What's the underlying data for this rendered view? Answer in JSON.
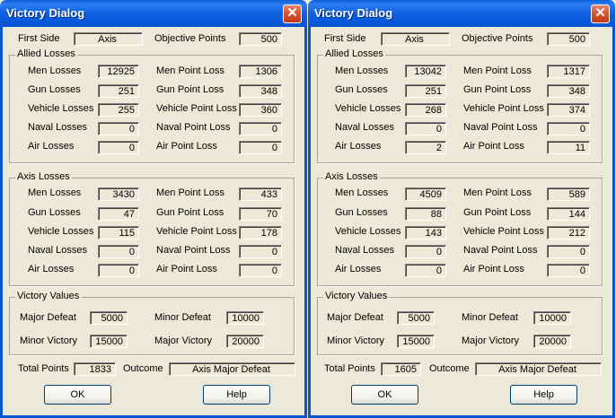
{
  "dialogs": [
    {
      "title": "Victory Dialog",
      "close_glyph": "✕",
      "labels": {
        "first_side": "First Side",
        "objective_points": "Objective Points",
        "allied_losses": "Allied Losses",
        "axis_losses": "Axis Losses",
        "men_losses": "Men Losses",
        "gun_losses": "Gun Losses",
        "vehicle_losses": "Vehicle Losses",
        "naval_losses": "Naval Losses",
        "air_losses": "Air Losses",
        "men_point_loss": "Men Point Loss",
        "gun_point_loss": "Gun Point Loss",
        "vehicle_point_loss": "Vehicle Point Loss",
        "naval_point_loss": "Naval Point Loss",
        "air_point_loss": "Air Point Loss",
        "victory_values": "Victory Values",
        "major_defeat": "Major Defeat",
        "minor_defeat": "Minor Defeat",
        "minor_victory": "Minor Victory",
        "major_victory": "Major Victory",
        "total_points": "Total Points",
        "outcome": "Outcome"
      },
      "first_side": "Axis",
      "objective_points": "500",
      "allied": {
        "men_losses": "12925",
        "gun_losses": "251",
        "vehicle_losses": "255",
        "naval_losses": "0",
        "air_losses": "0",
        "men_point_loss": "1306",
        "gun_point_loss": "348",
        "vehicle_point_loss": "360",
        "naval_point_loss": "0",
        "air_point_loss": "0"
      },
      "axis": {
        "men_losses": "3430",
        "gun_losses": "47",
        "vehicle_losses": "115",
        "naval_losses": "0",
        "air_losses": "0",
        "men_point_loss": "433",
        "gun_point_loss": "70",
        "vehicle_point_loss": "178",
        "naval_point_loss": "0",
        "air_point_loss": "0"
      },
      "victory": {
        "major_defeat": "5000",
        "minor_defeat": "10000",
        "minor_victory": "15000",
        "major_victory": "20000"
      },
      "total_points": "1833",
      "outcome": "Axis Major Defeat",
      "buttons": {
        "ok": "OK",
        "help": "Help"
      }
    },
    {
      "title": "Victory Dialog",
      "close_glyph": "✕",
      "labels": {
        "first_side": "First Side",
        "objective_points": "Objective Points",
        "allied_losses": "Allied Losses",
        "axis_losses": "Axis Losses",
        "men_losses": "Men Losses",
        "gun_losses": "Gun Losses",
        "vehicle_losses": "Vehicle Losses",
        "naval_losses": "Naval Losses",
        "air_losses": "Air Losses",
        "men_point_loss": "Men Point Loss",
        "gun_point_loss": "Gun Point Loss",
        "vehicle_point_loss": "Vehicle Point Loss",
        "naval_point_loss": "Naval Point Loss",
        "air_point_loss": "Air Point Loss",
        "victory_values": "Victory Values",
        "major_defeat": "Major Defeat",
        "minor_defeat": "Minor Defeat",
        "minor_victory": "Minor Victory",
        "major_victory": "Major Victory",
        "total_points": "Total Points",
        "outcome": "Outcome"
      },
      "first_side": "Axis",
      "objective_points": "500",
      "allied": {
        "men_losses": "13042",
        "gun_losses": "251",
        "vehicle_losses": "268",
        "naval_losses": "0",
        "air_losses": "2",
        "men_point_loss": "1317",
        "gun_point_loss": "348",
        "vehicle_point_loss": "374",
        "naval_point_loss": "0",
        "air_point_loss": "11"
      },
      "axis": {
        "men_losses": "4509",
        "gun_losses": "88",
        "vehicle_losses": "143",
        "naval_losses": "0",
        "air_losses": "0",
        "men_point_loss": "589",
        "gun_point_loss": "144",
        "vehicle_point_loss": "212",
        "naval_point_loss": "0",
        "air_point_loss": "0"
      },
      "victory": {
        "major_defeat": "5000",
        "minor_defeat": "10000",
        "minor_victory": "15000",
        "major_victory": "20000"
      },
      "total_points": "1605",
      "outcome": "Axis Major Defeat",
      "buttons": {
        "ok": "OK",
        "help": "Help"
      }
    }
  ]
}
